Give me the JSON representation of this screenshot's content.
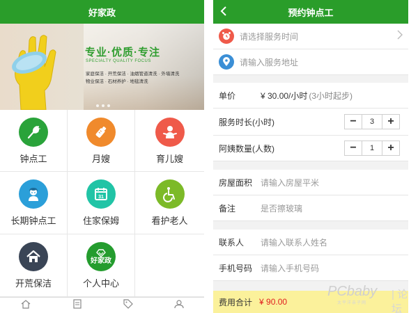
{
  "left": {
    "title": "好家政",
    "banner": {
      "headline": "专业·优质·专注",
      "subline": "SPECIALTY QUALITY FOCUS",
      "services_line1": "家庭保洁 · 开荒保洁 · 油烟管道清洗 · 外墙清洗",
      "services_line2": "物业保洁 · 石材养护 · 地毯清洗"
    },
    "grid": [
      {
        "label": "钟点工",
        "icon": "feather-duster-icon",
        "color": "#2aa33a"
      },
      {
        "label": "月嫂",
        "icon": "baby-bottle-icon",
        "color": "#f08a2c"
      },
      {
        "label": "育儿嫂",
        "icon": "baby-icon",
        "color": "#ef5a4a"
      },
      {
        "label": "长期钟点工",
        "icon": "worker-icon",
        "color": "#2b9fd9"
      },
      {
        "label": "住家保姆",
        "icon": "calendar-icon",
        "color": "#21c4a6"
      },
      {
        "label": "看护老人",
        "icon": "wheelchair-icon",
        "color": "#7cba28"
      },
      {
        "label": "开荒保洁",
        "icon": "house-icon",
        "color": "#3a4556"
      },
      {
        "label": "个人中心",
        "icon": "personal-center-icon",
        "color": "#249c2e",
        "badge_text": "好家政"
      }
    ],
    "bottom_nav": [
      "home-icon",
      "list-icon",
      "tag-icon",
      "user-icon"
    ]
  },
  "right": {
    "title": "预约钟点工",
    "time_placeholder": "请选择服务时间",
    "address_placeholder": "请输入服务地址",
    "price_label": "单价",
    "price_value": "¥ 30.00/小时",
    "price_note": "(3小时起步)",
    "duration_label": "服务时长(小时)",
    "duration_value": "3",
    "count_label": "阿姨数量(人数)",
    "count_value": "1",
    "area_label": "房屋面积",
    "area_placeholder": "请输入房屋平米",
    "remark_label": "备注",
    "remark_placeholder": "是否擦玻璃",
    "contact_label": "联系人",
    "contact_placeholder": "请输入联系人姓名",
    "phone_label": "手机号码",
    "phone_placeholder": "请输入手机号码",
    "total_label": "费用合计",
    "total_value": "¥ 90.00",
    "minus": "−",
    "plus": "+"
  },
  "watermark": {
    "brand": "PCbaby",
    "sub": "太平洋亲子网",
    "forum": "| 论坛"
  }
}
